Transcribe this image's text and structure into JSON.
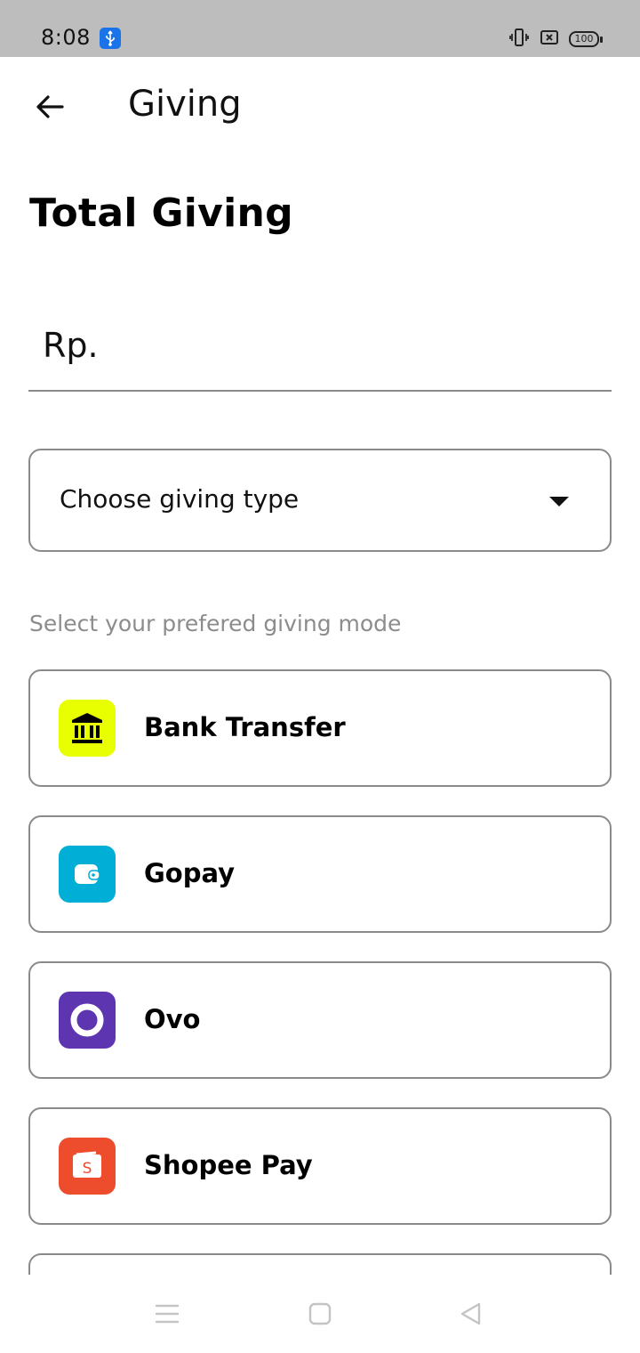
{
  "status_bar": {
    "time": "8:08",
    "battery": "100",
    "icons": [
      "usb-icon",
      "vibrate-icon",
      "no-sim-icon",
      "battery-icon"
    ]
  },
  "app_bar": {
    "title": "Giving",
    "back_icon": "arrow-left-icon"
  },
  "total_giving": {
    "title": "Total Giving",
    "amount_prefix": "Rp."
  },
  "giving_type": {
    "placeholder": "Choose giving type",
    "icon": "caret-down-icon"
  },
  "giving_mode": {
    "hint": "Select your prefered giving mode",
    "options": [
      {
        "label": "Bank Transfer",
        "icon": "bank-icon",
        "color": "#e8ff00"
      },
      {
        "label": "Gopay",
        "icon": "wallet-icon",
        "color": "#00aed6"
      },
      {
        "label": "Ovo",
        "icon": "ovo-icon",
        "color": "#5e35b1"
      },
      {
        "label": "Shopee Pay",
        "icon": "shopee-bag-icon",
        "color": "#ee4d2d"
      }
    ]
  },
  "nav_bar": {
    "items": [
      "menu-icon",
      "home-square-icon",
      "back-triangle-icon"
    ]
  },
  "colors": {
    "status_bar_bg": "#bdbdbd",
    "border": "#8a8a8a",
    "hint_text": "#8c8c8c"
  }
}
